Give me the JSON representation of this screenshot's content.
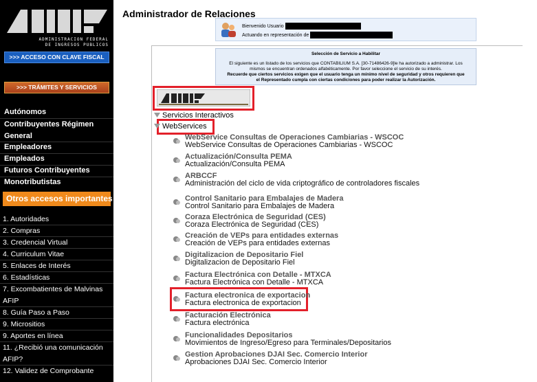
{
  "sidebar": {
    "logo_line1": "ADMINISTRACION FEDERAL",
    "logo_line2": "DE INGRESOS PUBLICOS",
    "clave_fiscal_button": ">>> ACCESO CON CLAVE FISCAL",
    "tramites_button": ">>> TRÁMITES Y SERVICIOS",
    "categories": [
      "Autónomos",
      "Contribuyentes Régimen General",
      "Empleadores",
      "Empleados",
      "Futuros Contribuyentes",
      "Monotributistas"
    ],
    "cat_line1": "Contribuyentes Régimen",
    "cat_line2": "General",
    "otros_header": "Otros accesos importantes",
    "items": [
      "1. Autoridades",
      "2. Compras",
      "3. Credencial Virtual",
      "4. Curriculum Vitae",
      "5. Enlaces de Interés",
      "6. Estadísticas",
      "7. Excombatientes de Malvinas",
      "AFIP",
      "8. Guía Paso a Paso",
      "9. Micrositios",
      "9. Aportes en línea",
      "11. ¿Recibió una comunicación",
      "AFIP?",
      "12. Validez de Comprobante"
    ]
  },
  "header": {
    "title": "Administrador de Relaciones",
    "welcome_label": "Bienvenido Usuario",
    "acting_label": "Actuando en representación de"
  },
  "info": {
    "title": "Selección de Servicio a Habilitar",
    "line1": "El siguiente es un listado de los servicios que CONTABILIUM S.A. [30-71486426-9]le ha autorizado a administrar. Los",
    "line2": "mismos se encuentran ordenados alfabéticamente. Por favor seleccione el servicio de su interés.",
    "line3": "Recuerde que ciertos servicios exigen que el usuario tenga un mínimo nivel de seguridad y otros requieren que",
    "line4": "el Representado cumpla con ciertas condiciones para poder realizar la Autorización."
  },
  "tree": {
    "interactive": "Servicios Interactivos",
    "webservices": "WebServices"
  },
  "services": [
    {
      "title": "WebService Consultas de Operaciones Cambiarias - WSCOC",
      "desc": "WebService Consultas de Operaciones Cambiarias - WSCOC"
    },
    {
      "title": "Actualización/Consulta PEMA",
      "desc": "Actualización/Consulta PEMA"
    },
    {
      "title": "ARBCCF",
      "desc": "Administración del ciclo de vida criptográfico de controladores fiscales"
    },
    {
      "title": "Control Sanitario para Embalajes de Madera",
      "desc": "Control Sanitario para Embalajes de Madera"
    },
    {
      "title": "Coraza Electrónica de Seguridad (CES)",
      "desc": "Coraza Electrónica de Seguridad (CES)"
    },
    {
      "title": "Creación de VEPs para entidades externas",
      "desc": "Creación de VEPs para entidades externas"
    },
    {
      "title": "Digitalizacion de Depositario Fiel",
      "desc": "Digitalizacion de Depositario Fiel"
    },
    {
      "title": "Factura Electrónica con Detalle - MTXCA",
      "desc": "Factura Electrónica con Detalle - MTXCA"
    },
    {
      "title": "Factura electronica de exportacion",
      "desc": "Factura electronica de exportacion"
    },
    {
      "title": "Facturación Electrónica",
      "desc": "Factura electrónica"
    },
    {
      "title": "Funcionalidades Depositarios",
      "desc": "Movimientos de Ingreso/Egreso para Terminales/Depositarios"
    },
    {
      "title": "Gestion Aprobaciones DJAI Sec. Comercio Interior",
      "desc": "Aprobaciones DJAI Sec. Comercio Interior"
    }
  ],
  "colors": {
    "highlight": "#e3202a",
    "otros_bg": "#f08a1c",
    "sidebar_bg": "#000000"
  }
}
